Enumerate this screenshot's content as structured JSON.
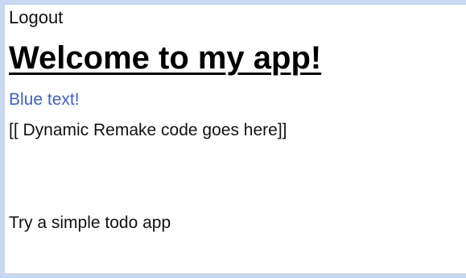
{
  "nav": {
    "logout_label": "Logout"
  },
  "main": {
    "title": "Welcome to my app!",
    "blue_text": "Blue text!",
    "dynamic_placeholder": "[[ Dynamic Remake code goes here]]",
    "todo_link_label": "Try a simple todo app"
  },
  "colors": {
    "page_background": "#c8d8f0",
    "content_background": "#ffffff",
    "text": "#111111",
    "blue_text": "#3a5ee0"
  }
}
